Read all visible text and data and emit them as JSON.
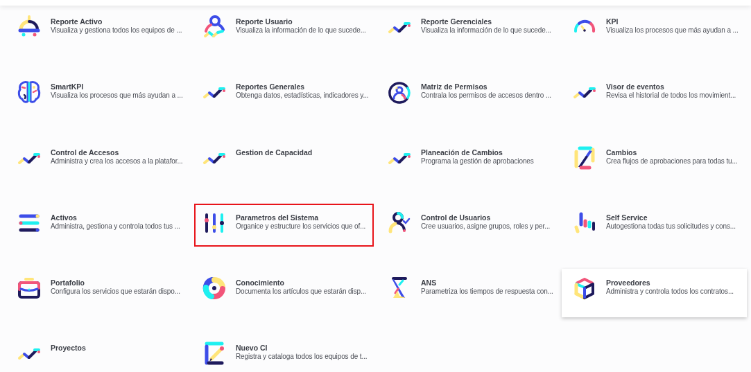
{
  "modules": [
    {
      "title": "Reporte Activo",
      "description": "Visualiza y gestiona todos los equipos de ...",
      "kind": "lamp",
      "highlighted": false,
      "hovered": false
    },
    {
      "title": "Reporte Usuario",
      "description": "Visualiza la información de lo que sucede...",
      "kind": "user-trend",
      "highlighted": false,
      "hovered": false
    },
    {
      "title": "Reporte Gerenciales",
      "description": "Visualiza la información de lo que sucede...",
      "kind": "trend",
      "highlighted": false,
      "hovered": false
    },
    {
      "title": "KPI",
      "description": "Visualiza los procesos que más ayudan a ...",
      "kind": "gauge",
      "highlighted": false,
      "hovered": false
    },
    {
      "title": "SmartKPI",
      "description": "Visualiza los procesos que más ayudan a ...",
      "kind": "brain",
      "highlighted": false,
      "hovered": false
    },
    {
      "title": "Reportes Generales",
      "description": "Obtenga datos, estadísticas, indicadores y...",
      "kind": "trend",
      "highlighted": false,
      "hovered": false
    },
    {
      "title": "Matriz de Permisos",
      "description": "Contrala los permisos de accesos dentro ...",
      "kind": "user-circle",
      "highlighted": false,
      "hovered": false
    },
    {
      "title": "Visor de eventos",
      "description": "Revisa el historial de todos los movimient...",
      "kind": "trend",
      "highlighted": false,
      "hovered": false
    },
    {
      "title": "Control de Accesos",
      "description": "Administra y crea los accesos a la platafor...",
      "kind": "trend",
      "highlighted": false,
      "hovered": false
    },
    {
      "title": "Gestion de Capacidad",
      "kind": "trend",
      "highlighted": false,
      "hovered": false
    },
    {
      "title": "Planeación de Cambios",
      "description": "Programa la gestión de aprobaciones",
      "kind": "trend",
      "highlighted": false,
      "hovered": false
    },
    {
      "title": "Cambios",
      "description": "Crea flujos de aprobaciones para todas tu...",
      "kind": "z-frame",
      "highlighted": false,
      "hovered": false
    },
    {
      "title": "Activos",
      "description": "Administra, gestiona y controla todos tus ...",
      "kind": "list-bars",
      "highlighted": false,
      "hovered": false
    },
    {
      "title": "Parametros del Sistema",
      "description": "Organice y estructure los servicios que of...",
      "kind": "sliders",
      "highlighted": true,
      "hovered": false
    },
    {
      "title": "Control de Usuarios",
      "description": "Cree usuarios, asigne grupos, roles y per...",
      "kind": "user-check",
      "highlighted": false,
      "hovered": false
    },
    {
      "title": "Self Service",
      "description": "Autogestiona todas tus solicitudes y cons...",
      "kind": "bars",
      "highlighted": false,
      "hovered": false
    },
    {
      "title": "Portafolio",
      "description": "Configura los servicios que estarán dispo...",
      "kind": "briefcase",
      "highlighted": false,
      "hovered": false
    },
    {
      "title": "Conocimiento",
      "description": "Documenta los artículos que estarán disp...",
      "kind": "ring",
      "highlighted": false,
      "hovered": false
    },
    {
      "title": "ANS",
      "description": "Parametriza los tiempos de respuesta con...",
      "kind": "hourglass",
      "highlighted": false,
      "hovered": false
    },
    {
      "title": "Proveedores",
      "description": "Administra y controla todos los contratos...",
      "kind": "cube",
      "highlighted": false,
      "hovered": true
    },
    {
      "title": "Proyectos",
      "kind": "trend",
      "highlighted": false,
      "hovered": false
    },
    {
      "title": "Nuevo CI",
      "description": "Registra y cataloga todos los equipos de t...",
      "kind": "pencil-frame",
      "highlighted": false,
      "hovered": false
    }
  ]
}
